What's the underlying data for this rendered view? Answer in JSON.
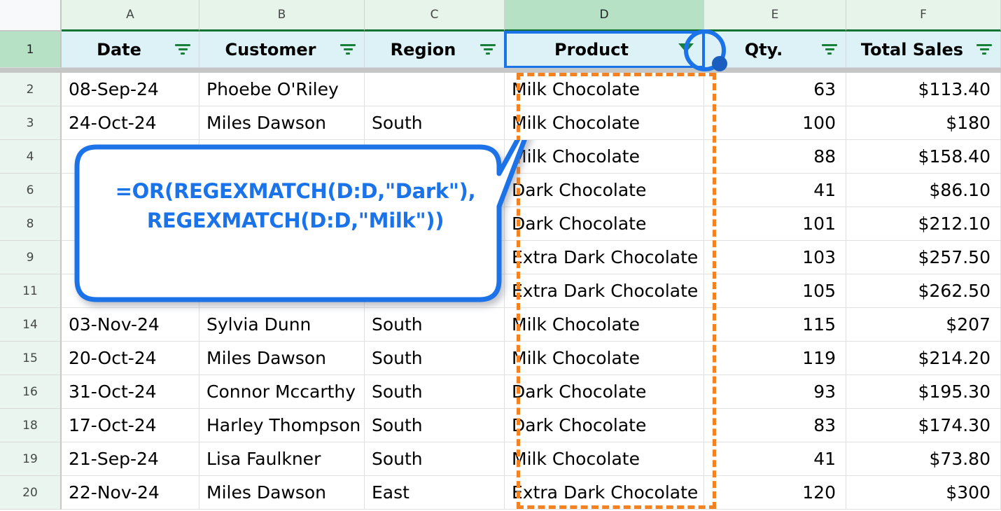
{
  "spreadsheet": {
    "column_headers": [
      {
        "letter": "A",
        "selected": false
      },
      {
        "letter": "B",
        "selected": false
      },
      {
        "letter": "C",
        "selected": false
      },
      {
        "letter": "D",
        "selected": true
      },
      {
        "letter": "E",
        "selected": false
      },
      {
        "letter": "F",
        "selected": false
      }
    ],
    "header_row": {
      "row_number": "1",
      "cells": [
        {
          "label": "Date",
          "icon": "filter-bars-icon",
          "active": false
        },
        {
          "label": "Customer",
          "icon": "filter-bars-icon",
          "active": false
        },
        {
          "label": "Region",
          "icon": "filter-bars-icon",
          "active": false
        },
        {
          "label": "Product",
          "icon": "funnel-icon",
          "active": true
        },
        {
          "label": "Qty.",
          "icon": "filter-bars-icon",
          "active": false
        },
        {
          "label": "Total Sales",
          "icon": "filter-bars-icon",
          "active": false
        }
      ]
    },
    "rows": [
      {
        "n": "2",
        "date": "08-Sep-24",
        "customer": "Phoebe O'Riley",
        "region": "",
        "product": "Milk Chocolate",
        "qty": "63",
        "total": "$113.40"
      },
      {
        "n": "3",
        "date": "24-Oct-24",
        "customer": "Miles Dawson",
        "region": "South",
        "product": "Milk Chocolate",
        "qty": "100",
        "total": "$180"
      },
      {
        "n": "4",
        "date": "",
        "customer": "",
        "region": "",
        "product": "Milk Chocolate",
        "qty": "88",
        "total": "$158.40"
      },
      {
        "n": "6",
        "date": "",
        "customer": "",
        "region": "",
        "product": "Dark Chocolate",
        "qty": "41",
        "total": "$86.10"
      },
      {
        "n": "8",
        "date": "",
        "customer": "",
        "region": "",
        "product": "Dark Chocolate",
        "qty": "101",
        "total": "$212.10"
      },
      {
        "n": "9",
        "date": "",
        "customer": "",
        "region": "",
        "product": "Extra Dark Chocolate",
        "qty": "103",
        "total": "$257.50"
      },
      {
        "n": "11",
        "date": "",
        "customer": "",
        "region": "",
        "product": "Extra Dark Chocolate",
        "qty": "105",
        "total": "$262.50"
      },
      {
        "n": "14",
        "date": "03-Nov-24",
        "customer": "Sylvia Dunn",
        "region": "South",
        "product": "Milk Chocolate",
        "qty": "115",
        "total": "$207"
      },
      {
        "n": "15",
        "date": "20-Oct-24",
        "customer": "Miles Dawson",
        "region": "South",
        "product": "Milk Chocolate",
        "qty": "119",
        "total": "$214.20"
      },
      {
        "n": "16",
        "date": "31-Oct-24",
        "customer": "Connor Mccarthy",
        "region": "South",
        "product": "Dark Chocolate",
        "qty": "93",
        "total": "$195.30"
      },
      {
        "n": "18",
        "date": "17-Oct-24",
        "customer": "Harley Thompson",
        "region": "South",
        "product": "Dark Chocolate",
        "qty": "83",
        "total": "$174.30"
      },
      {
        "n": "19",
        "date": "21-Sep-24",
        "customer": "Lisa Faulkner",
        "region": "South",
        "product": "Milk Chocolate",
        "qty": "41",
        "total": "$73.80"
      },
      {
        "n": "20",
        "date": "22-Nov-24",
        "customer": "Miles Dawson",
        "region": "East",
        "product": "Extra Dark Chocolate",
        "qty": "120",
        "total": "$300"
      }
    ]
  },
  "annotations": {
    "callout": {
      "line1": "=OR(REGEXMATCH(D:D,\"Dark\"),",
      "line2": "REGEXMATCH(D:D,\"Milk\"))"
    },
    "circle_target": "funnel-icon-product-column"
  },
  "colors": {
    "accent_blue": "#1a73e8",
    "dash_orange": "#f58220",
    "header_green": "#e6f4ea",
    "header_green_selected": "#b7e1c4",
    "header_cell_blue": "#ddf2f7",
    "filter_icon_green": "#188038",
    "freeze_line": "#137333"
  }
}
